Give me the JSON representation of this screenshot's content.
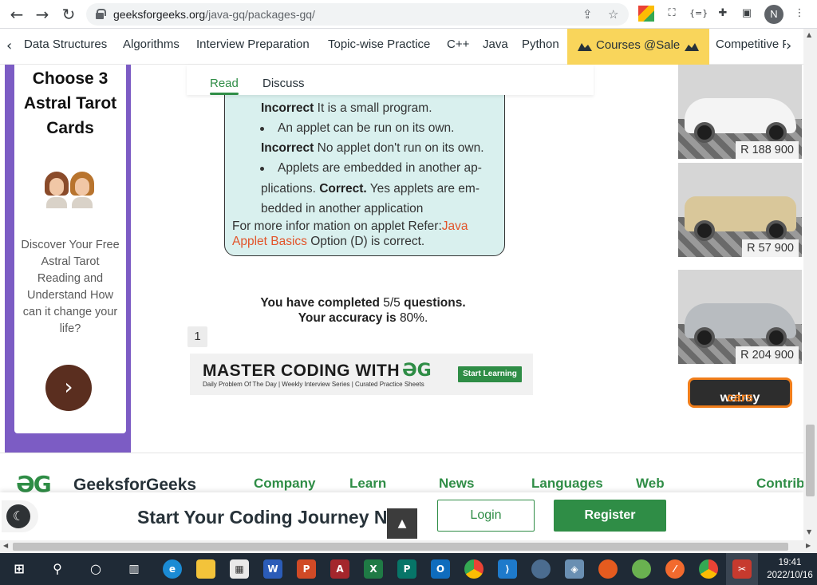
{
  "browser": {
    "url_domain": "geeksforgeeks.org",
    "url_path": "/java-gq/packages-gq/",
    "profile_initial": "N"
  },
  "site_nav": {
    "items": [
      "Data Structures",
      "Algorithms",
      "Interview Preparation",
      "Topic-wise Practice",
      "C++",
      "Java",
      "Python"
    ],
    "courses_label": "Courses @Sale",
    "last_item": "Competitive P"
  },
  "left_ad": {
    "heading": "Choose 3 Astral Tarot Cards",
    "text": "Discover Your Free Astral Tarot Reading and Understand How can it change your life?"
  },
  "tabs": {
    "read": "Read",
    "discuss": "Discuss"
  },
  "explanation": {
    "l1_bold": "Incorrect",
    "l1_text": " It is a small program.",
    "l2_bullet": "An applet can be run on its own.",
    "l3_bold": "Incorrect",
    "l3_text": " No applet don't run on its own.",
    "l4_bullet": "Applets are embedded in another ap-",
    "l5_text": "plications. ",
    "l5_bold": "Correct.",
    "l5_rest": " Yes applets are em-",
    "l6_text": "bedded in another application",
    "l7_text": "For more infor mation on applet Refer:",
    "l7_link": "Java",
    "l8_link": "Applet Basics",
    "l8_text": " Option (D) is correct."
  },
  "result": {
    "l1_a": "You have completed ",
    "l1_b": "5/5",
    "l1_c": " questions.",
    "l2_a": "Your accuracy is ",
    "l2_b": "80%."
  },
  "pagination": {
    "page": "1"
  },
  "banner": {
    "headline": "MASTER CODING WITH",
    "logo": "ƏG",
    "sub": "Daily Problem Of The Day  |  Weekly Interview Series  |  Curated Practice Sheets",
    "cta": "Start Learning"
  },
  "car_ads": [
    {
      "price": "R 188 900",
      "color": "#f4f4f4"
    },
    {
      "price": "R 57 900",
      "color": "#d9c79a"
    },
    {
      "price": "R 204 900",
      "color": "#b8bcc0"
    }
  ],
  "webuycars": {
    "part1": "webuy",
    "part2": "cars"
  },
  "footer": {
    "logo": "ƏG",
    "brand": "GeeksforGeeks",
    "columns": [
      "Company",
      "Learn",
      "News",
      "Languages",
      "Web",
      "Contrib"
    ]
  },
  "cta_bar": {
    "headline": "Start Your Coding Journey Now!",
    "login": "Login",
    "register": "Register"
  },
  "taskbar": {
    "time": "19:41",
    "date": "2022/10/16"
  },
  "colors": {
    "gfg_green": "#2f8d46",
    "sale_yellow": "#f9d55b",
    "explain_bg": "#d9f0ee",
    "link_orange": "#e2542a"
  }
}
